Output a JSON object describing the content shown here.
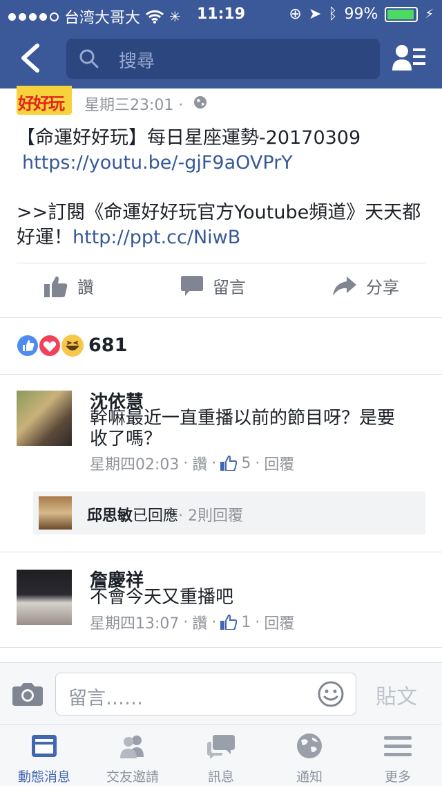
{
  "status_bar": {
    "carrier": "台湾大哥大",
    "time": "11:19",
    "battery": "99%"
  },
  "header": {
    "search_placeholder": "搜尋"
  },
  "post": {
    "timestamp": "星期三23:01 ·",
    "logo_text": "好好玩",
    "line1": "【命運好好玩】每日星座運勢-20170309",
    "link1": "https://youtu.be/-gjF9aOVPrY",
    "line2": ">>訂閱《命運好好玩官方Youtube頻道》天天都",
    "line3": "好運！",
    "link2": "http://ppt.cc/NiwB",
    "actions": {
      "like": "讚",
      "comment": "留言",
      "share": "分享"
    },
    "reaction_count": "681"
  },
  "comments": [
    {
      "name": "沈依慧",
      "text_line1": "幹嘛最近一直重播以前的節目呀？是要",
      "text_line2": "收了嗎？",
      "time": "星期四02:03",
      "like_label": "讚",
      "like_count": "5",
      "reply_label": "回覆"
    },
    {
      "name": "詹慶祥",
      "text_line1": "不會今天又重播吧",
      "time": "星期四13:07",
      "like_label": "讚",
      "like_count": "1",
      "reply_label": "回覆"
    }
  ],
  "reply_summary": {
    "name": "邱思敏",
    "action": "已回應",
    "replies": "· 2則回覆"
  },
  "composer": {
    "placeholder": "留言……",
    "post_label": "貼文"
  },
  "tabs": [
    {
      "label": "動態消息"
    },
    {
      "label": "交友邀請"
    },
    {
      "label": "訊息"
    },
    {
      "label": "通知"
    },
    {
      "label": "更多"
    }
  ],
  "colors": {
    "brand": "#3b5998",
    "link": "#365899",
    "like_blue": "#4267b2"
  }
}
